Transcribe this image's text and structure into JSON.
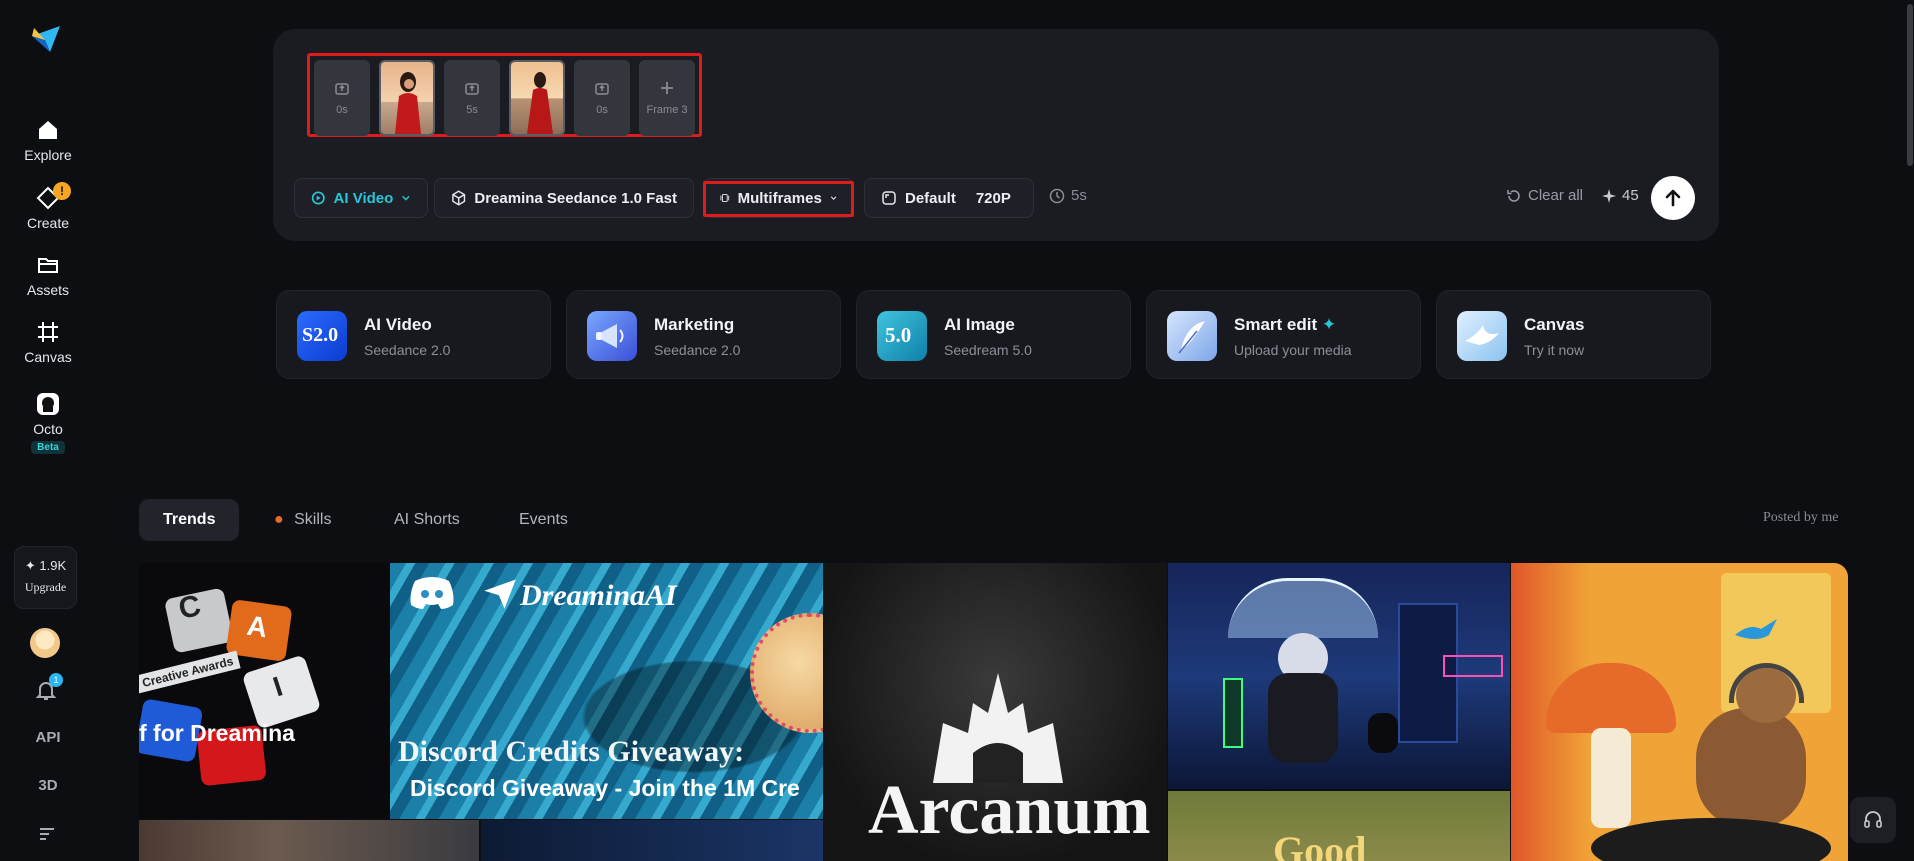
{
  "sidebar": {
    "items": [
      {
        "label": "Explore",
        "icon": "home-icon"
      },
      {
        "label": "Create",
        "icon": "create-icon",
        "badge": "!"
      },
      {
        "label": "Assets",
        "icon": "folder-icon"
      },
      {
        "label": "Canvas",
        "icon": "canvas-icon"
      },
      {
        "label": "Octo",
        "icon": "octo-icon",
        "tag": "Beta"
      }
    ],
    "credits": "1.9K",
    "upgrade_label": "Upgrade",
    "notification_count": "1",
    "api_label": "API",
    "threed_label": "3D"
  },
  "composer": {
    "frames": [
      {
        "type": "slot",
        "duration": "0s"
      },
      {
        "type": "image"
      },
      {
        "type": "slot",
        "duration": "5s"
      },
      {
        "type": "image"
      },
      {
        "type": "slot",
        "duration": "0s"
      },
      {
        "type": "add",
        "label": "Frame 3"
      }
    ],
    "toolbar": {
      "mode": "AI Video",
      "model": "Dreamina Seedance 1.0 Fast",
      "frames_mode": "Multiframes",
      "ratio": "Default",
      "resolution": "720P",
      "duration": "5s",
      "clear_all": "Clear all",
      "cost": "45"
    }
  },
  "quick_cards": [
    {
      "title": "AI Video",
      "subtitle": "Seedance 2.0",
      "thumb": "S2.0"
    },
    {
      "title": "Marketing",
      "subtitle": "Seedance 2.0"
    },
    {
      "title": "AI Image",
      "subtitle": "Seedream 5.0",
      "thumb": "5.0"
    },
    {
      "title": "Smart edit",
      "subtitle": "Upload your media"
    },
    {
      "title": "Canvas",
      "subtitle": "Try it now"
    }
  ],
  "tabs": [
    "Trends",
    "Skills",
    "AI Shorts",
    "Events"
  ],
  "posted_by": "Posted by me",
  "gallery": {
    "tile1_text": "f for Dreamina",
    "tile1_keys": [
      "C",
      "A",
      "I"
    ],
    "tile1_caption": "Creative Awards",
    "tile2_brand": "DreaminaAI",
    "tile2_headline": "Discord Credits Giveaway:",
    "tile2_sub": "Discord Giveaway - Join the 1M Cre",
    "tile3_text": "Arcanum",
    "tile5_text": "Good"
  },
  "colors": {
    "accent_teal": "#27c6d8",
    "highlight_red": "#e01b1b",
    "background": "#0d0e12",
    "panel": "#1b1c22"
  }
}
